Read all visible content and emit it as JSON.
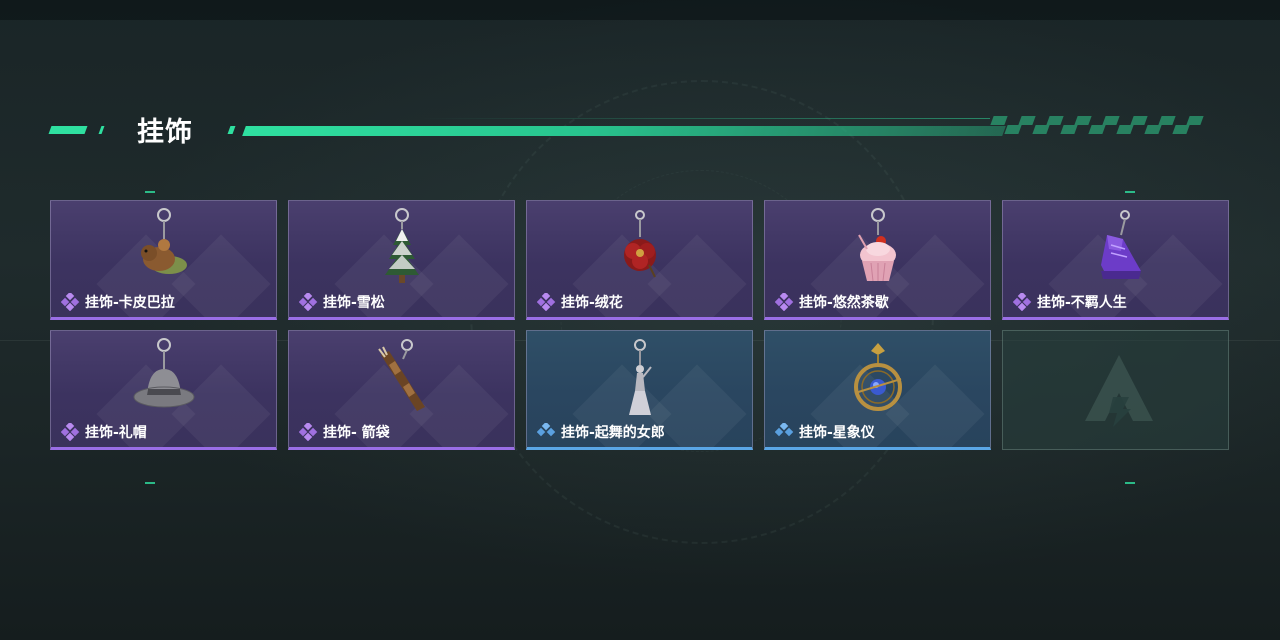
{
  "header": {
    "title": "挂饰"
  },
  "colors": {
    "accent": "#2fe0a0",
    "rare_purple": "#9a6ee6",
    "rare_blue": "#5aa6e6"
  },
  "items": [
    {
      "label": "挂饰-卡皮巴拉",
      "rarity": "purple",
      "icon": "capybara-charm-icon"
    },
    {
      "label": "挂饰-雪松",
      "rarity": "purple",
      "icon": "snow-pine-charm-icon"
    },
    {
      "label": "挂饰-绒花",
      "rarity": "purple",
      "icon": "velvet-flower-charm-icon"
    },
    {
      "label": "挂饰-悠然茶歇",
      "rarity": "purple",
      "icon": "cupcake-charm-icon"
    },
    {
      "label": "挂饰-不羁人生",
      "rarity": "purple",
      "icon": "sneaker-charm-icon"
    },
    {
      "label": "挂饰-礼帽",
      "rarity": "purple",
      "icon": "hat-charm-icon"
    },
    {
      "label": "挂饰- 箭袋",
      "rarity": "purple",
      "icon": "quiver-charm-icon"
    },
    {
      "label": "挂饰-起舞的女郎",
      "rarity": "blue",
      "icon": "dancer-charm-icon"
    },
    {
      "label": "挂饰-星象仪",
      "rarity": "blue",
      "icon": "astrolabe-charm-icon"
    },
    {
      "label": "",
      "rarity": "empty",
      "icon": "empty-slot-logo-icon"
    }
  ]
}
